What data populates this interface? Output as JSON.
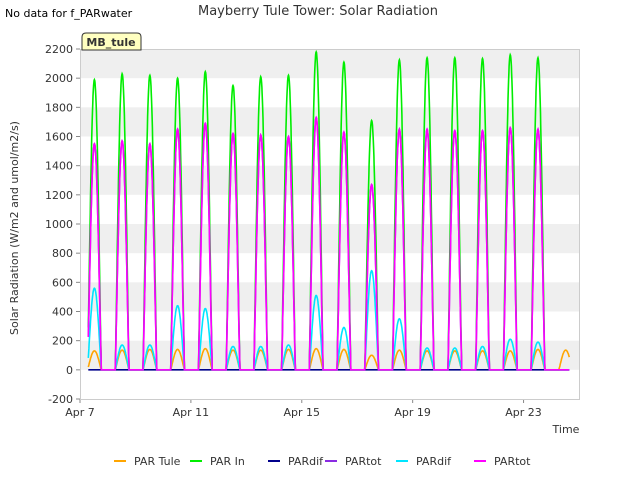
{
  "note_text": "No data for f_PARwater",
  "chart_data": {
    "type": "line",
    "title": "Mayberry Tule Tower: Solar Radiation",
    "xlabel": "Time",
    "ylabel": "Solar Radiation (W/m2 and umol/m2/s)",
    "ylim": [
      -200,
      2200
    ],
    "yticks": [
      -200,
      0,
      200,
      400,
      600,
      800,
      1000,
      1200,
      1400,
      1600,
      1800,
      2000,
      2200
    ],
    "xlim": [
      0,
      18
    ],
    "xticks": [
      {
        "day": 0,
        "label": "Apr 7"
      },
      {
        "day": 4,
        "label": "Apr 11"
      },
      {
        "day": 8,
        "label": "Apr 15"
      },
      {
        "day": 12,
        "label": "Apr 19"
      },
      {
        "day": 16,
        "label": "Apr 23"
      }
    ],
    "grid": "horizontal-bands",
    "legend_position": "bottom",
    "site_label": "MB_tule",
    "days": [
      "Apr 7",
      "Apr 8",
      "Apr 9",
      "Apr 10",
      "Apr 11",
      "Apr 12",
      "Apr 13",
      "Apr 14",
      "Apr 15",
      "Apr 16",
      "Apr 17",
      "Apr 18",
      "Apr 19",
      "Apr 20",
      "Apr 21",
      "Apr 22",
      "Apr 23",
      "Apr 24"
    ],
    "series": [
      {
        "name": "PAR Tule",
        "color": "#ffa500",
        "daily_peak": [
          130,
          135,
          140,
          140,
          145,
          135,
          135,
          140,
          145,
          140,
          100,
          135,
          130,
          130,
          130,
          130,
          140,
          135
        ]
      },
      {
        "name": "PAR In",
        "color": "#00ee00",
        "daily_peak": [
          1990,
          2030,
          2020,
          2000,
          2045,
          1950,
          2010,
          2020,
          2180,
          2110,
          1710,
          2125,
          2140,
          2140,
          2135,
          2160,
          2140,
          0
        ]
      },
      {
        "name": "PARdif",
        "color": "#00008b",
        "daily_peak": [
          0,
          0,
          0,
          0,
          0,
          0,
          0,
          0,
          0,
          0,
          0,
          0,
          0,
          0,
          0,
          0,
          0,
          0
        ]
      },
      {
        "name": "PARtot",
        "color": "#8a2be2",
        "daily_peak": [
          1550,
          1570,
          1550,
          1650,
          1690,
          1620,
          1610,
          1600,
          1730,
          1630,
          1270,
          1650,
          1650,
          1640,
          1640,
          1660,
          1650,
          0
        ]
      },
      {
        "name": "PARdif",
        "color": "#00e5ff",
        "daily_peak": [
          560,
          170,
          170,
          440,
          420,
          160,
          160,
          170,
          510,
          290,
          680,
          350,
          150,
          150,
          160,
          210,
          190,
          0
        ]
      },
      {
        "name": "PARtot",
        "color": "#ff00ff",
        "daily_peak": [
          1550,
          1570,
          1550,
          1650,
          1690,
          1620,
          1610,
          1600,
          1730,
          1630,
          1270,
          1650,
          1650,
          1640,
          1640,
          1660,
          1650,
          0
        ]
      }
    ]
  }
}
